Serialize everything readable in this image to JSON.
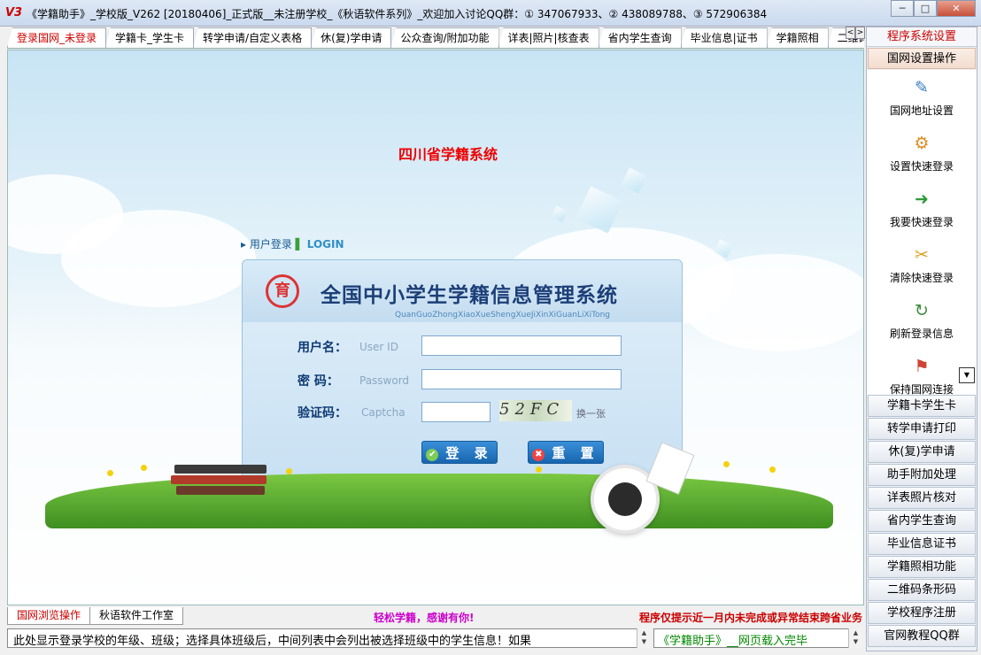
{
  "window": {
    "title": "《学籍助手》_学校版_V262 [20180406]_正式版__未注册学校_《秋语软件系列》_欢迎加入讨论QQ群：① 347067933、② 438089788、③ 572906384",
    "app_icon": "V3",
    "controls": [
      "─",
      "□",
      "✕"
    ]
  },
  "tabs": [
    {
      "label": "登录国网_未登录",
      "active": true
    },
    {
      "label": "学籍卡_学生卡"
    },
    {
      "label": "转学申请/自定义表格"
    },
    {
      "label": "休(复)学申请"
    },
    {
      "label": "公众查询/附加功能"
    },
    {
      "label": "详表|照片|核查表"
    },
    {
      "label": "省内学生查询"
    },
    {
      "label": "毕业信息|证书"
    },
    {
      "label": "学籍照相"
    },
    {
      "label": "二维码"
    }
  ],
  "tab_scroll": [
    "<",
    ">"
  ],
  "login_page": {
    "province_title": "四川省学籍系统",
    "login_label_prefix": "▸ 用户登录",
    "login_label_sep": "▌",
    "login_label_en": "LOGIN",
    "logo_char": "育",
    "system_title": "全国中小学生学籍信息管理系统",
    "system_pinyin": "QuanGuoZhongXiaoXueShengXueJiXinXiGuanLiXiTong",
    "username_label": "用户名：",
    "username_hint": "User ID",
    "password_label": "密  码：",
    "password_hint": "Password",
    "captcha_label": "验证码：",
    "captcha_hint": "Captcha",
    "captcha_text": "52FC",
    "captcha_refresh": "换一张",
    "login_button": "登 录",
    "reset_button": "重 置",
    "login_icon": "✔",
    "reset_icon": "✖"
  },
  "bottom_tabs": [
    {
      "label": "国网浏览操作",
      "active": true
    },
    {
      "label": "秋语软件工作室"
    }
  ],
  "slogan": "轻松学籍，感谢有你!",
  "notice": "程序仅提示近一月内未完成或异常结束跨省业务",
  "status_left": "   此处显示登录学校的年级、班级；选择具体班级后，中间列表中会列出被选择班级中的学生信息！如果",
  "status_right": "《学籍助手》__网页载入完毕",
  "right_panel": {
    "header": "程序系统设置",
    "sub_header": "国网设置操作",
    "tools": [
      {
        "label": "国网地址设置",
        "icon": "✎",
        "color": "#3a7cc4"
      },
      {
        "label": "设置快速登录",
        "icon": "⚙",
        "color": "#e08a1e"
      },
      {
        "label": "我要快速登录",
        "icon": "➜",
        "color": "#2f9a3a"
      },
      {
        "label": "清除快速登录",
        "icon": "✂",
        "color": "#d9a020"
      },
      {
        "label": "刷新登录信息",
        "icon": "↻",
        "color": "#3c8c3c"
      },
      {
        "label": "保持国网连接",
        "icon": "⚑",
        "color": "#c43"
      }
    ],
    "buttons": [
      "学籍卡学生卡",
      "转学申请打印",
      "休(复)学申请",
      "助手附加处理",
      "详表照片核对",
      "省内学生查询",
      "毕业信息证书",
      "学籍照相功能",
      "二维码条形码",
      "学校程序注册",
      "官网教程QQ群"
    ]
  }
}
